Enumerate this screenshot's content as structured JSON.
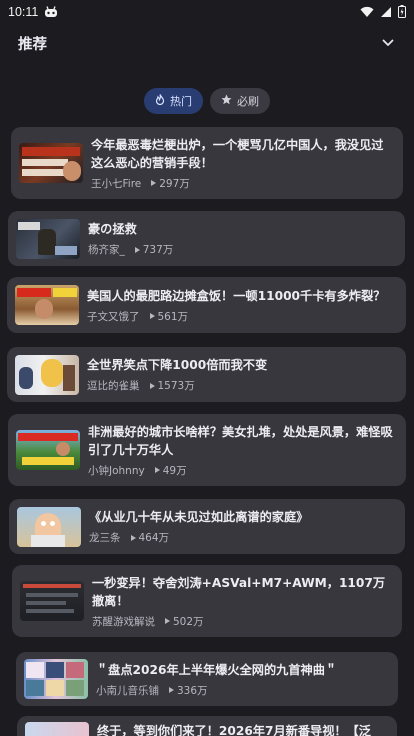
{
  "status": {
    "time": "10:11"
  },
  "header": {
    "title": "推荐"
  },
  "chips": [
    {
      "label": "热门",
      "icon": "flame-icon",
      "active": true
    },
    {
      "label": "必刷",
      "icon": "star-icon",
      "active": false
    }
  ],
  "videos": [
    {
      "title": "今年最恶毒烂梗出炉，一个梗骂几亿中国人，我没见过这么恶心的营销手段！",
      "author": "王小七Fire",
      "views": "297万"
    },
    {
      "title": "豪の拯救",
      "author": "杨齐家_",
      "views": "737万"
    },
    {
      "title": "美国人的最肥路边摊盒饭！一顿11000千卡有多炸裂？",
      "author": "子文又饿了",
      "views": "561万"
    },
    {
      "title": "全世界笑点下降1000倍而我不变",
      "author": "逗比的雀巢",
      "views": "1573万"
    },
    {
      "title": "非洲最好的城市长啥样？美女扎堆，处处是风景，难怪吸引了几十万华人",
      "author": "小钟Johnny",
      "views": "49万"
    },
    {
      "title": "《从业几十年从未见过如此离谱的家庭》",
      "author": "龙三条",
      "views": "464万"
    },
    {
      "title": "一秒变异！夺舍刘涛+ASVal+M7+AWM，1107万撤离！",
      "author": "苏醒游戏解说",
      "views": "502万"
    },
    {
      "title": "＂盘点2026年上半年爆火全网的九首神曲＂",
      "author": "小南儿音乐铺",
      "views": "336万"
    },
    {
      "title": "终于，等到你们来了！2026年7月新番导视！【泛",
      "author": "",
      "views": ""
    }
  ]
}
